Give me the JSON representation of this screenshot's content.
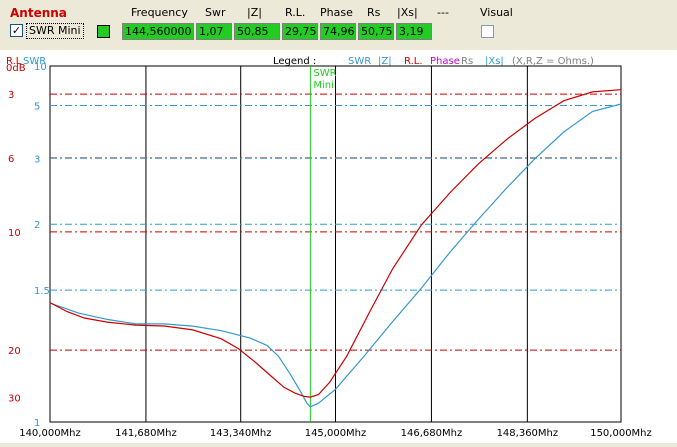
{
  "panel": {
    "antenna_title": "Antenna",
    "swr_mini_checked": true,
    "swr_mini_label": "SWR Mini",
    "headers": [
      "Frequency",
      "Swr",
      "|Z|",
      "R.L.",
      "Phase",
      "Rs",
      "|Xs|",
      "---",
      "Visual"
    ],
    "values": [
      "144,560000",
      "1,07",
      "50,85",
      "29,75",
      "74,96",
      "50,75",
      "3,19"
    ],
    "visual_checked": false
  },
  "chart": {
    "rl_swr_label_rl": "R.L",
    "rl_swr_label_swr": "SWR",
    "legend_label": "Legend :",
    "legend_items": [
      {
        "text": "SWR",
        "color": "#3399cc"
      },
      {
        "text": "|Z|",
        "color": "#3399cc"
      },
      {
        "text": "R.L.",
        "color": "#cc0000"
      },
      {
        "text": "Phase",
        "color": "#cc00cc"
      },
      {
        "text": "Rs",
        "color": "#808080"
      },
      {
        "text": "|Xs|",
        "color": "#3399cc"
      },
      {
        "text": "(X,R,Z = Ohms.)",
        "color": "#808080"
      }
    ],
    "marker_label_1": "SWR",
    "marker_label_2": "Mini"
  },
  "chart_data": {
    "type": "line",
    "x_ticks": [
      "140,000Mhz",
      "141,680Mhz",
      "143,340Mhz",
      "145,000Mhz",
      "146,680Mhz",
      "148,360Mhz",
      "150,000Mhz"
    ],
    "xlim": [
      140.0,
      150.0
    ],
    "rl_ticks": [
      "0dB",
      "3",
      "6",
      "10",
      "20",
      "30"
    ],
    "swr_ticks": [
      "10",
      "5",
      "3",
      "2",
      "1.5",
      "1"
    ],
    "rl_levels": [
      3,
      6,
      10,
      20
    ],
    "swr_levels": [
      5,
      3,
      2,
      1.5
    ],
    "marker_x": 144.56,
    "grid": true,
    "series": [
      {
        "name": "SWR",
        "color": "#3399cc",
        "x": [
          140.0,
          140.5,
          141.0,
          141.5,
          142.0,
          142.5,
          143.0,
          143.5,
          143.8,
          144.0,
          144.2,
          144.4,
          144.5,
          144.56,
          144.7,
          145.0,
          145.5,
          146.0,
          146.5,
          147.0,
          147.5,
          148.0,
          148.5,
          149.0,
          149.5,
          150.0
        ],
        "y": [
          1.43,
          1.38,
          1.35,
          1.33,
          1.33,
          1.32,
          1.3,
          1.27,
          1.24,
          1.2,
          1.14,
          1.08,
          1.05,
          1.04,
          1.05,
          1.09,
          1.2,
          1.34,
          1.51,
          1.75,
          2.05,
          2.45,
          3.0,
          3.75,
          4.65,
          5.1
        ]
      },
      {
        "name": "R.L.",
        "color": "#cc0000",
        "x": [
          140.0,
          140.3,
          140.6,
          141.0,
          141.5,
          142.0,
          142.5,
          143.0,
          143.3,
          143.6,
          143.9,
          144.1,
          144.3,
          144.45,
          144.56,
          144.7,
          144.9,
          145.2,
          145.6,
          146.0,
          146.5,
          147.0,
          147.5,
          148.0,
          148.5,
          149.0,
          149.5,
          150.0
        ],
        "y": [
          15.0,
          15.8,
          16.4,
          16.8,
          17.1,
          17.2,
          17.6,
          18.6,
          19.8,
          21.8,
          24.5,
          26.8,
          28.5,
          29.5,
          29.75,
          28.9,
          25.5,
          20.8,
          15.8,
          12.4,
          9.6,
          7.8,
          6.3,
          5.1,
          4.1,
          3.3,
          2.9,
          2.8
        ]
      }
    ]
  }
}
